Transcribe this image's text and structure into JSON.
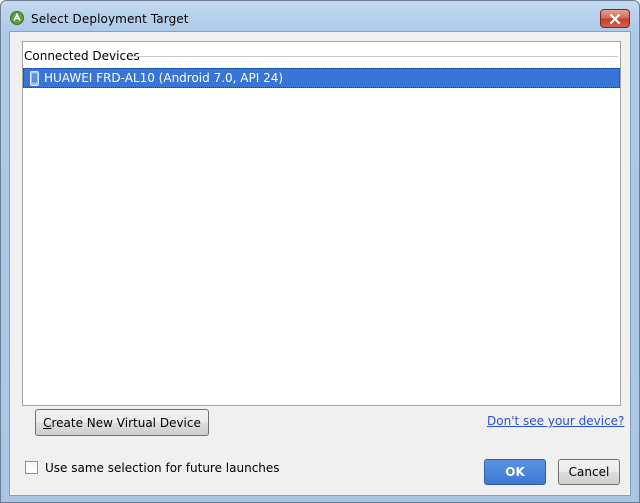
{
  "window": {
    "title": "Select Deployment Target",
    "app_icon": "android-studio-icon",
    "close_icon": "close-icon"
  },
  "device_list": {
    "group_label": "Connected Devices",
    "devices": [
      {
        "label": "HUAWEI FRD-AL10 (Android 7.0, API 24)",
        "icon": "phone-icon",
        "selected": true
      }
    ]
  },
  "actions": {
    "create_virtual_device": {
      "first_letter": "C",
      "rest": "reate New Virtual Device"
    },
    "help_link": "Don't see your device?",
    "remember_selection_label": "Use same selection for future launches",
    "remember_selection_checked": false,
    "ok_label": "OK",
    "cancel_label": "Cancel"
  },
  "colors": {
    "selection": "#3875d7",
    "link": "#2a50d3",
    "primary_button": "#4a84dc"
  }
}
